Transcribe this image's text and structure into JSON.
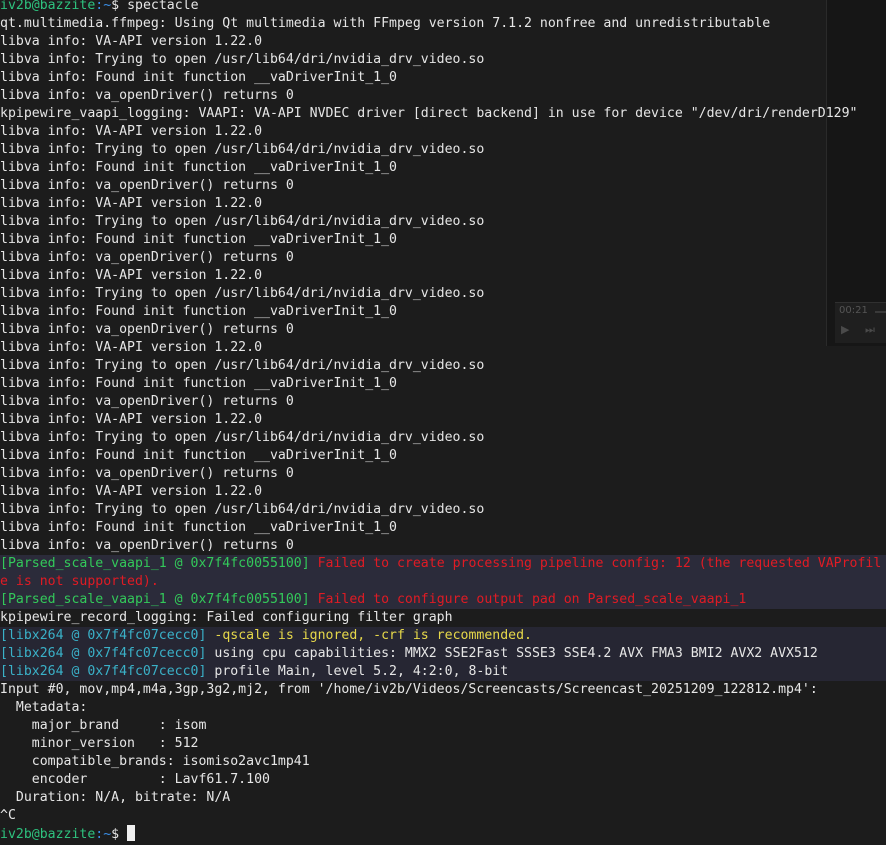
{
  "background_window": {
    "time_label": "00:21",
    "play_icon": "▶",
    "next_icon": "⏭"
  },
  "terminal": {
    "prompt_user": "iv2b@bazzite",
    "prompt_path": ":~",
    "prompt_symbol": "$",
    "command": " spectacle",
    "lines": [
      "qt.multimedia.ffmpeg: Using Qt multimedia with FFmpeg version 7.1.2 nonfree and unredistributable",
      "libva info: VA-API version 1.22.0",
      "libva info: Trying to open /usr/lib64/dri/nvidia_drv_video.so",
      "libva info: Found init function __vaDriverInit_1_0",
      "libva info: va_openDriver() returns 0",
      "kpipewire_vaapi_logging: VAAPI: VA-API NVDEC driver [direct backend] in use for device \"/dev/dri/renderD129\"",
      "libva info: VA-API version 1.22.0",
      "libva info: Trying to open /usr/lib64/dri/nvidia_drv_video.so",
      "libva info: Found init function __vaDriverInit_1_0",
      "libva info: va_openDriver() returns 0",
      "libva info: VA-API version 1.22.0",
      "libva info: Trying to open /usr/lib64/dri/nvidia_drv_video.so",
      "libva info: Found init function __vaDriverInit_1_0",
      "libva info: va_openDriver() returns 0",
      "libva info: VA-API version 1.22.0",
      "libva info: Trying to open /usr/lib64/dri/nvidia_drv_video.so",
      "libva info: Found init function __vaDriverInit_1_0",
      "libva info: va_openDriver() returns 0",
      "libva info: VA-API version 1.22.0",
      "libva info: Trying to open /usr/lib64/dri/nvidia_drv_video.so",
      "libva info: Found init function __vaDriverInit_1_0",
      "libva info: va_openDriver() returns 0",
      "libva info: VA-API version 1.22.0",
      "libva info: Trying to open /usr/lib64/dri/nvidia_drv_video.so",
      "libva info: Found init function __vaDriverInit_1_0",
      "libva info: va_openDriver() returns 0",
      "libva info: VA-API version 1.22.0",
      "libva info: Trying to open /usr/lib64/dri/nvidia_drv_video.so",
      "libva info: Found init function __vaDriverInit_1_0",
      "libva info: va_openDriver() returns 0"
    ],
    "error_1": {
      "tag": "[Parsed_scale_vaapi_1 @ 0x7f4fc0055100]",
      "msg_a": " Failed to create processing pipeline config: 12 (the requested VAProfil",
      "msg_b": "e is not supported)."
    },
    "error_2": {
      "tag": "[Parsed_scale_vaapi_1 @ 0x7f4fc0055100]",
      "msg": " Failed to configure output pad on Parsed_scale_vaapi_1"
    },
    "record_line": "kpipewire_record_logging: Failed configuring filter graph",
    "x264_1": {
      "tag": "[libx264 @ 0x7f4fc07cecc0]",
      "msg": " -qscale is ignored, -crf is recommended."
    },
    "x264_2": {
      "tag": "[libx264 @ 0x7f4fc07cecc0]",
      "msg": " using cpu capabilities: MMX2 SSE2Fast SSSE3 SSE4.2 AVX FMA3 BMI2 AVX2 AVX512"
    },
    "x264_3": {
      "tag": "[libx264 @ 0x7f4fc07cecc0]",
      "msg": " profile Main, level 5.2, 4:2:0, 8-bit"
    },
    "tail": [
      "Input #0, mov,mp4,m4a,3gp,3g2,mj2, from '/home/iv2b/Videos/Screencasts/Screencast_20251209_122812.mp4':",
      "  Metadata:",
      "    major_brand     : isom",
      "    minor_version   : 512",
      "    compatible_brands: isomiso2avc1mp41",
      "    encoder         : Lavf61.7.100",
      "  Duration: N/A, bitrate: N/A",
      "^C"
    ]
  },
  "colors": {
    "background": "#1c1c1c",
    "text": "#e6e6e6",
    "prompt_user": "#2ec27e",
    "prompt_path": "#3a8ee6",
    "error": "#e01b24",
    "ffmpeg_tag": "#33c95a",
    "x264_tag": "#3ab1c8",
    "warning": "#e6d84a"
  }
}
